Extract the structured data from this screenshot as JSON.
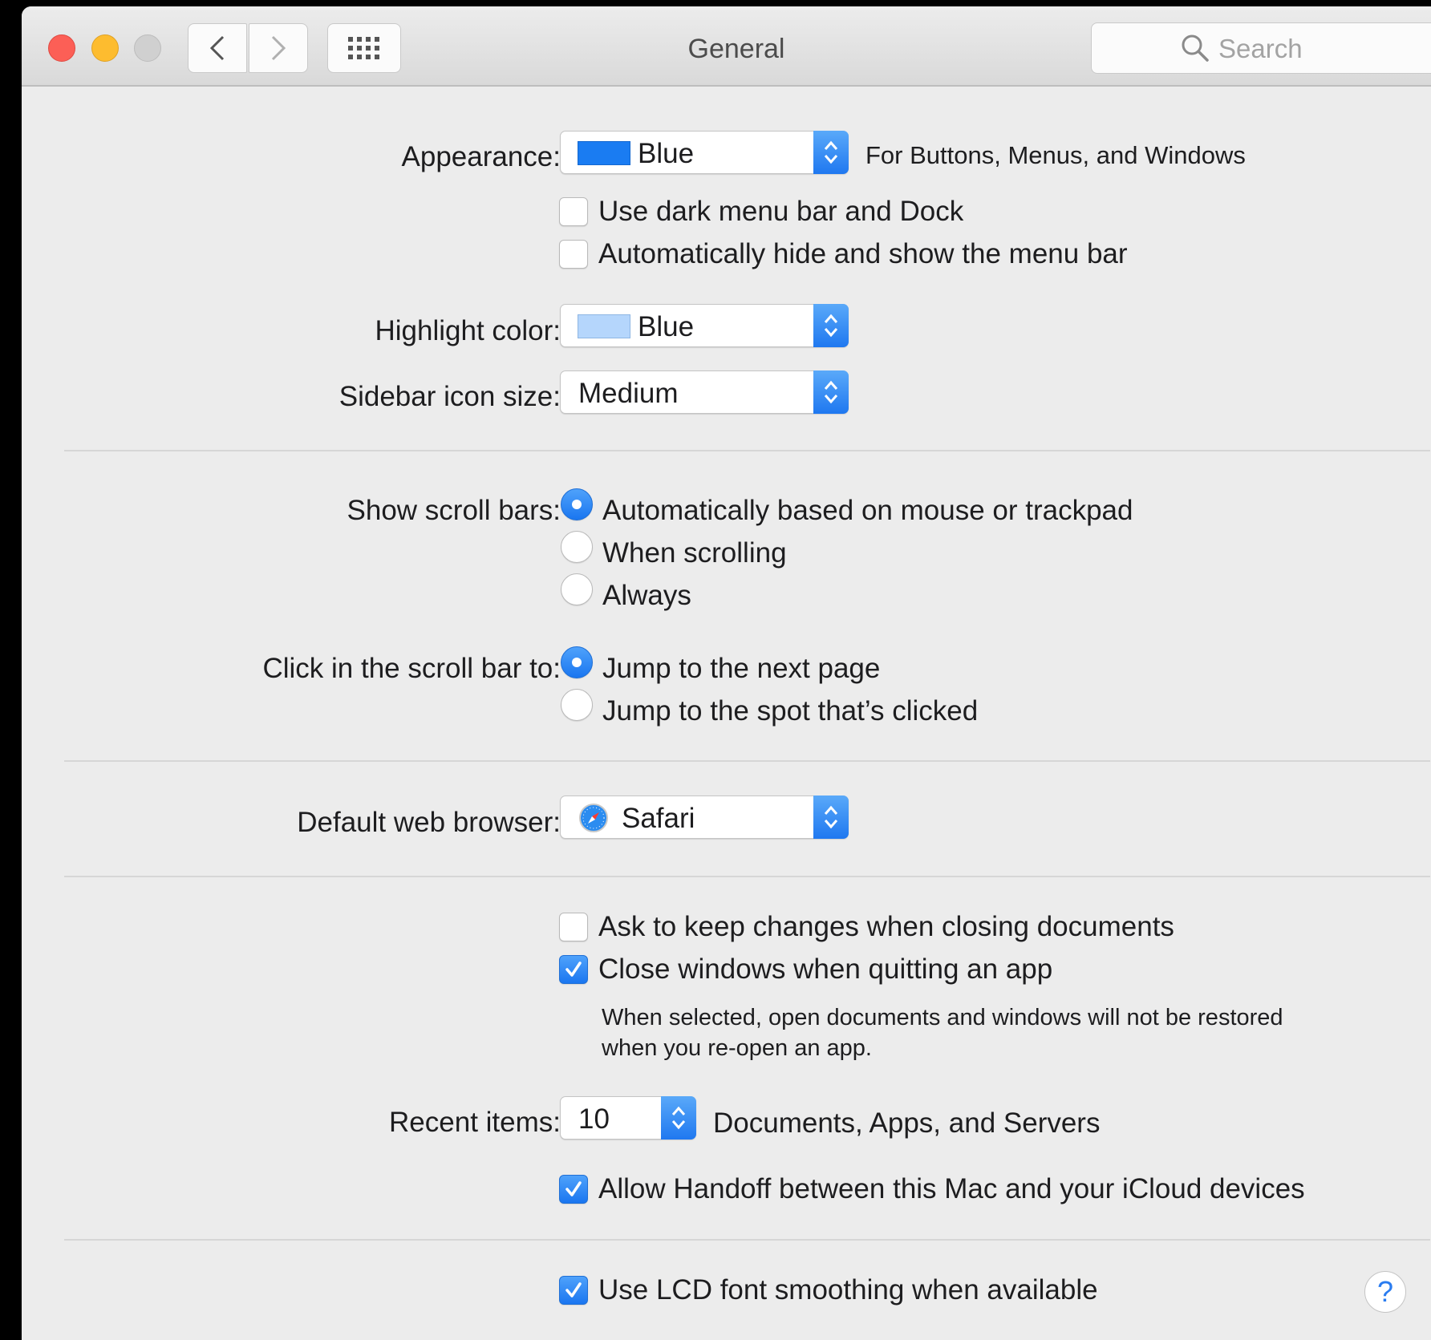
{
  "window": {
    "title": "General"
  },
  "search": {
    "placeholder": "Search"
  },
  "appearance": {
    "label": "Appearance:",
    "value": "Blue",
    "swatch_color": "#1a7cf2",
    "note": "For Buttons, Menus, and Windows"
  },
  "dark_menu": {
    "label": "Use dark menu bar and Dock",
    "checked": false
  },
  "auto_hide": {
    "label": "Automatically hide and show the menu bar",
    "checked": false
  },
  "highlight": {
    "label": "Highlight color:",
    "value": "Blue",
    "swatch_color": "#b5d6fc"
  },
  "sidebar_size": {
    "label": "Sidebar icon size:",
    "value": "Medium"
  },
  "scroll_bars": {
    "label": "Show scroll bars:",
    "options": [
      "Automatically based on mouse or trackpad",
      "When scrolling",
      "Always"
    ],
    "selected": 0
  },
  "click_scroll": {
    "label": "Click in the scroll bar to:",
    "options": [
      "Jump to the next page",
      "Jump to the spot that’s clicked"
    ],
    "selected": 0
  },
  "browser": {
    "label": "Default web browser:",
    "value": "Safari"
  },
  "ask_keep": {
    "label": "Ask to keep changes when closing documents",
    "checked": false
  },
  "close_windows": {
    "label": "Close windows when quitting an app",
    "checked": true,
    "note_line1": "When selected, open documents and windows will not be restored",
    "note_line2": "when you re-open an app."
  },
  "recent": {
    "label": "Recent items:",
    "value": "10",
    "suffix": "Documents, Apps, and Servers"
  },
  "handoff": {
    "label": "Allow Handoff between this Mac and your iCloud devices",
    "checked": true
  },
  "lcd": {
    "label": "Use LCD font smoothing when available",
    "checked": true
  },
  "help": {
    "symbol": "?"
  },
  "colors": {
    "accent": "#1a76f0",
    "window_bg": "#ececec",
    "close": "#fc5f56",
    "minimize": "#fdbc2f",
    "zoom_disabled": "#d0d0d0"
  }
}
